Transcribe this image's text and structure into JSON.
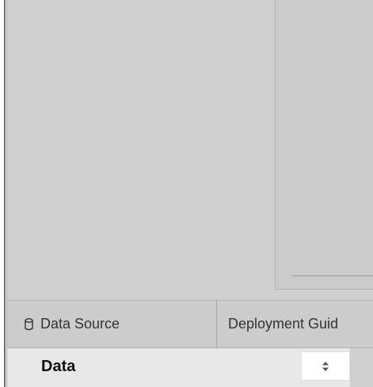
{
  "tabs": [
    {
      "label": "Data Source",
      "icon": "database-icon"
    },
    {
      "label": "Deployment Guid"
    }
  ],
  "data_pane": {
    "title": "Data",
    "sort_icon": "sort-updown-icon"
  },
  "colors": {
    "canvas_bg": "#cfcfcf",
    "tab_bar_bg": "#c9c9c9",
    "bottom_bar_bg": "#e8e8e8"
  }
}
